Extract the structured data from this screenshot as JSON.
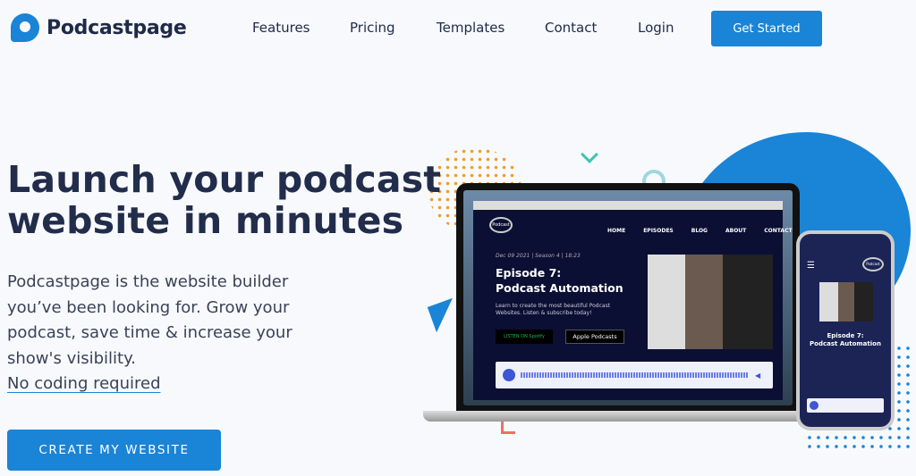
{
  "header": {
    "brand": "Podcastpage",
    "nav": [
      "Features",
      "Pricing",
      "Templates",
      "Contact",
      "Login"
    ],
    "cta": "Get Started"
  },
  "hero": {
    "title_line1": "Launch your podcast",
    "title_line2": "website in minutes",
    "lead": "Podcastpage is the website builder you’ve been looking for. Grow your podcast, save time & increase your show's visibility.",
    "no_code": "No coding required",
    "cta": "CREATE MY WEBSITE"
  },
  "mockup": {
    "logo": "Podcast",
    "nav": [
      "HOME",
      "EPISODES",
      "BLOG",
      "ABOUT",
      "CONTACT"
    ],
    "meta": "Dec 09 2021 | Season 4 | 18:23",
    "title1": "Episode 7:",
    "title2": "Podcast Automation",
    "desc": "Learn to create the most beautiful Podcast Websites. Listen & subscribe today!",
    "spotify": "LISTEN ON Spotify",
    "apple": "Apple Podcasts"
  },
  "colors": {
    "brand": "#1a84d6",
    "text": "#1f2a48",
    "accent_orange": "#f39a2c"
  }
}
